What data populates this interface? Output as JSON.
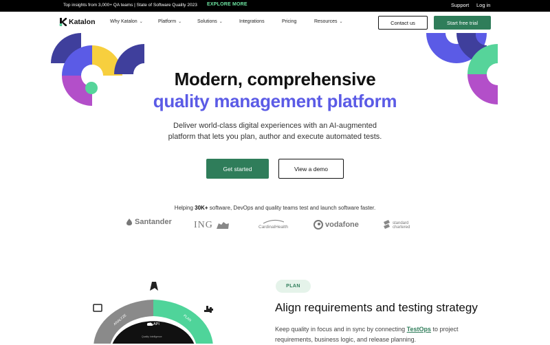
{
  "topbar": {
    "promo": "Top insights from 3,000+ QA teams | State of Software Quality 2023",
    "explore": "EXPLORE MORE",
    "support": "Support",
    "login": "Log in"
  },
  "nav": {
    "brand": "Katalon",
    "items": [
      {
        "label": "Why Katalon",
        "dropdown": true
      },
      {
        "label": "Platform",
        "dropdown": true
      },
      {
        "label": "Solutions",
        "dropdown": true
      },
      {
        "label": "Integrations",
        "dropdown": false
      },
      {
        "label": "Pricing",
        "dropdown": false
      },
      {
        "label": "Resources",
        "dropdown": true
      }
    ],
    "contact": "Contact us",
    "trial": "Start free trial"
  },
  "hero": {
    "title_line1": "Modern, comprehensive",
    "title_line2": "quality management platform",
    "subtitle_line1": "Deliver world-class digital experiences with an AI-augmented",
    "subtitle_line2": "platform that lets you plan, author and execute automated tests.",
    "primary_cta": "Get started",
    "secondary_cta": "View a demo"
  },
  "social_proof": {
    "prefix": "Helping ",
    "highlight": "30K+",
    "suffix": " software, DevOps and quality teams test and launch software faster.",
    "customers": [
      "Santander",
      "ING",
      "CardinalHealth",
      "vodafone",
      "standard chartered"
    ]
  },
  "feature": {
    "badge": "PLAN",
    "title": "Align requirements and testing strategy",
    "body_prefix": "Keep quality in focus and in sync by connecting ",
    "body_link": "TestOps",
    "body_suffix": " to project requirements, business logic, and release planning.",
    "diagram_labels": {
      "analyze": "ANALYZE",
      "plan": "PLAN",
      "api": "API",
      "inner": "Quality Intelligence"
    }
  },
  "colors": {
    "accent_green": "#2f7d5a",
    "brand_purple": "#5b5be6",
    "deco_purple": "#b34fc9",
    "deco_yellow": "#f7cf3e",
    "deco_navy": "#3f3f9c",
    "deco_mint": "#56d49a"
  }
}
